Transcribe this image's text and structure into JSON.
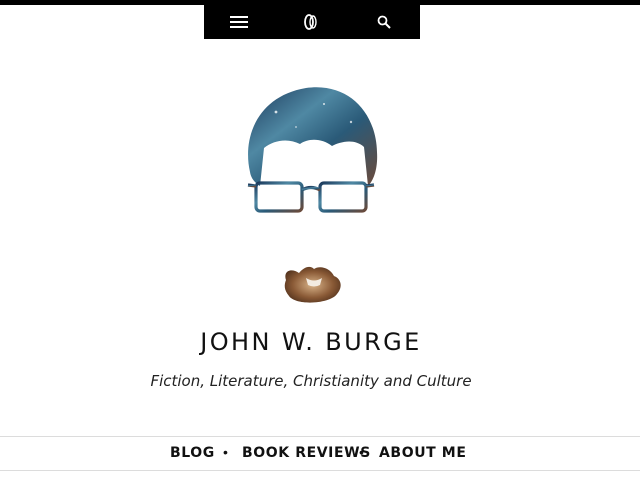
{
  "toolbar": {
    "menu_icon": "hamburger-menu-icon",
    "logo_icon": "site-logo-icon",
    "search_icon": "search-icon",
    "background": "#000000"
  },
  "header": {
    "title": "JOHN W. BURGE",
    "tagline": "Fiction, Literature, Christianity and Culture"
  },
  "nav": {
    "items": [
      {
        "label": "BLOG"
      },
      {
        "label": "BOOK REVIEWS"
      },
      {
        "label": "ABOUT ME"
      }
    ],
    "separator": "•"
  }
}
